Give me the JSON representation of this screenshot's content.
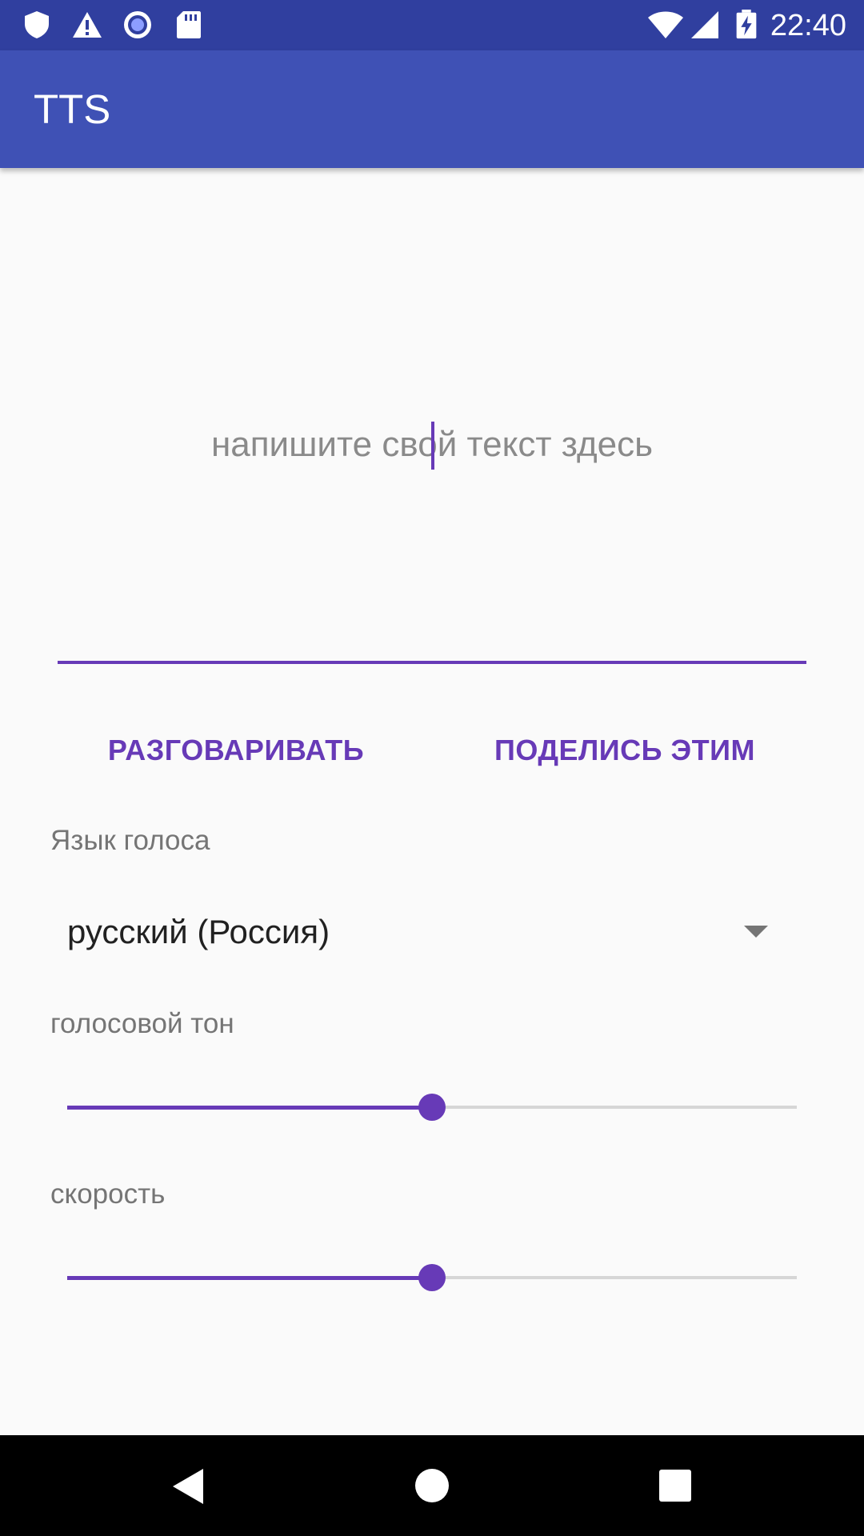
{
  "status_bar": {
    "time": "22:40",
    "icons": [
      "shield-icon",
      "warning-icon",
      "record-icon",
      "sd-card-icon",
      "wifi-icon",
      "cell-signal-icon",
      "battery-charging-icon"
    ]
  },
  "app_bar": {
    "title": "TTS"
  },
  "text_input": {
    "placeholder": "напишите свой текст здесь",
    "value": ""
  },
  "buttons": {
    "speak_label": "РАЗГОВАРИВАТЬ",
    "share_label": "ПОДЕЛИСЬ ЭТИМ"
  },
  "language": {
    "label": "Язык голоса",
    "selected": "русский (Россия)"
  },
  "pitch": {
    "label": "голосовой тон",
    "value_fraction": 0.5
  },
  "speed": {
    "label": "скорость",
    "value_fraction": 0.5
  },
  "nav_bar": {
    "icons": [
      "back-icon",
      "home-icon",
      "recents-icon"
    ]
  },
  "colors": {
    "status_bar": "#303f9f",
    "app_bar": "#3f51b5",
    "accent": "#673ab7",
    "background": "#fafafa"
  }
}
